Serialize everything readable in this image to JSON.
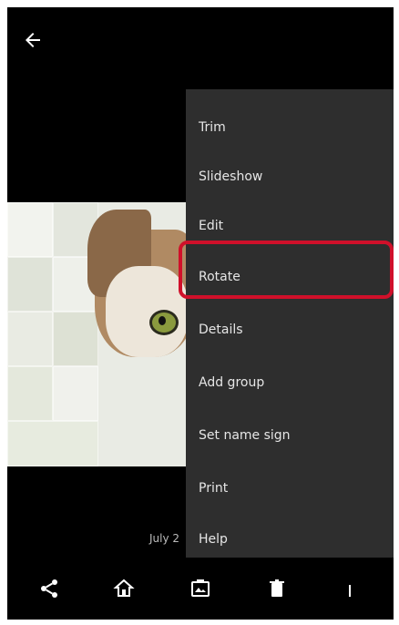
{
  "header": {
    "back_icon": "back-arrow-icon"
  },
  "menu": {
    "items": [
      {
        "label": "Trim"
      },
      {
        "label": "Slideshow"
      },
      {
        "label": "Edit"
      },
      {
        "label": "Rotate"
      },
      {
        "label": "Details"
      },
      {
        "label": "Add group"
      },
      {
        "label": "Set name sign"
      },
      {
        "label": "Print"
      },
      {
        "label": "Help"
      }
    ],
    "highlighted_index": 3,
    "highlight_color": "#d0102a"
  },
  "photo": {
    "time_label": "July 2"
  },
  "bottom_bar": {
    "icons": [
      "share-icon",
      "home-icon",
      "album-icon",
      "delete-icon",
      "more-icon"
    ]
  }
}
